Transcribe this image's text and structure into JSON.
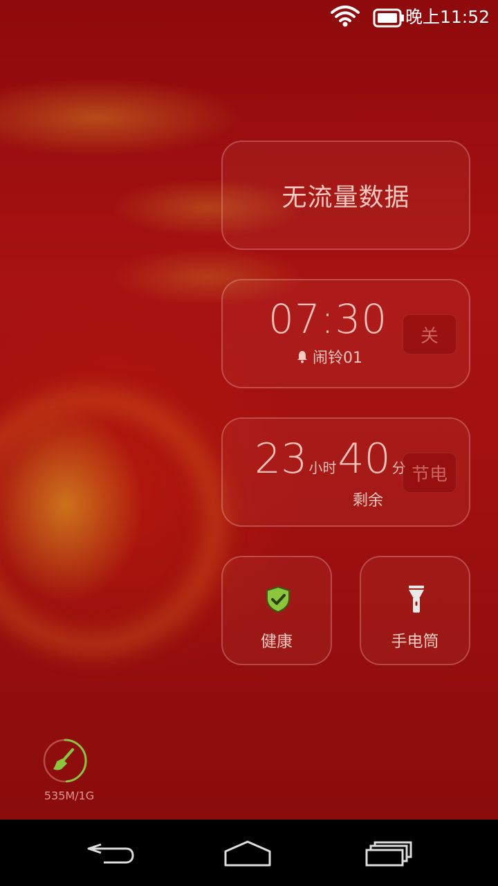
{
  "status_bar": {
    "time": "晚上11:52",
    "wifi_icon": "wifi-icon",
    "battery_icon": "battery-icon"
  },
  "data_card": {
    "label": "无流量数据"
  },
  "alarm_card": {
    "time": "07:30",
    "alarm_name": "闹铃01",
    "toggle_label": "关",
    "icon": "bell-icon"
  },
  "battery_card": {
    "hours": "23",
    "hours_unit": "小时",
    "minutes": "40",
    "minutes_unit": "分",
    "remaining_label": "剩余",
    "power_save_label": "节电"
  },
  "tiles": [
    {
      "label": "健康",
      "icon": "shield-check-icon",
      "accent": "#8cc63f"
    },
    {
      "label": "手电筒",
      "icon": "flashlight-icon"
    }
  ],
  "memory": {
    "label": "535M/1G",
    "icon": "broom-icon",
    "usage_fraction": 0.52,
    "accent": "#8cc63f"
  },
  "nav_bar": {
    "back_icon": "back-icon",
    "home_icon": "home-icon",
    "recent_icon": "recent-apps-icon"
  }
}
